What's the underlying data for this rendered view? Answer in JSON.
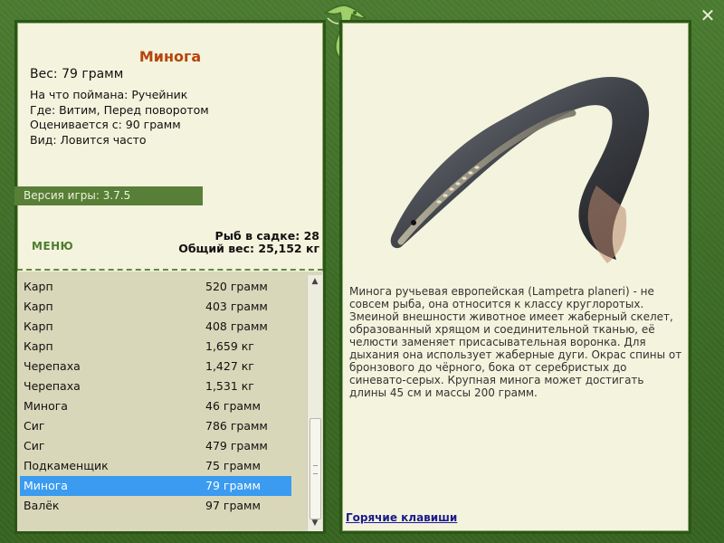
{
  "fish": {
    "title": "Минога",
    "weight": "Вес: 79 грамм",
    "caught_on": "На что поймана: Ручейник",
    "location": "Где: Витим, Перед поворотом",
    "rated_from": "Оценивается с: 90 грамм",
    "kind": "Вид: Ловится часто"
  },
  "version": "Версия игры: 3.7.5",
  "menu_label": "МЕНЮ",
  "stats": {
    "count": "Рыб в садке: 28",
    "total_weight": "Общий вес: 25,152 кг"
  },
  "catch_list": [
    {
      "name": "Карп",
      "weight": "520 грамм"
    },
    {
      "name": "Карп",
      "weight": "403 грамм"
    },
    {
      "name": "Карп",
      "weight": "408 грамм"
    },
    {
      "name": "Карп",
      "weight": "1,659 кг"
    },
    {
      "name": "Черепаха",
      "weight": "1,427 кг"
    },
    {
      "name": "Черепаха",
      "weight": "1,531 кг"
    },
    {
      "name": "Минога",
      "weight": "46 грамм"
    },
    {
      "name": "Сиг",
      "weight": "786 грамм"
    },
    {
      "name": "Сиг",
      "weight": "479 грамм"
    },
    {
      "name": "Подкаменщик",
      "weight": "75 грамм"
    },
    {
      "name": "Минога",
      "weight": "79 грамм"
    },
    {
      "name": "Валёк",
      "weight": "97 грамм"
    }
  ],
  "selected_index": 10,
  "description": "Минога ручьевая европейская (Lampetra planeri) - не совсем рыба, она относится к классу круглоротых. Змеиной внешности животное имеет жаберный скелет, образованный хрящом и соединительной тканью, её челюсти заменяет присасывательная воронка. Для дыхания она использует жаберные дуги. Окрас спины от бронзового до чёрного, бока от серебристых до синевато-серых. Крупная минога может достигать длины 45 см и массы 200 грамм.",
  "hotkeys": "Горячие клавиши",
  "icons": {
    "close": "close-icon",
    "logo": "lizard-logo-icon",
    "scroll_up": "arrow-up-icon",
    "scroll_down": "arrow-down-icon"
  },
  "colors": {
    "accent_title": "#b8440c",
    "frame_green": "#3f6e28",
    "panel_bg": "#f4f3dd",
    "selection": "#3a9bf0",
    "link": "#1a1a8c"
  }
}
